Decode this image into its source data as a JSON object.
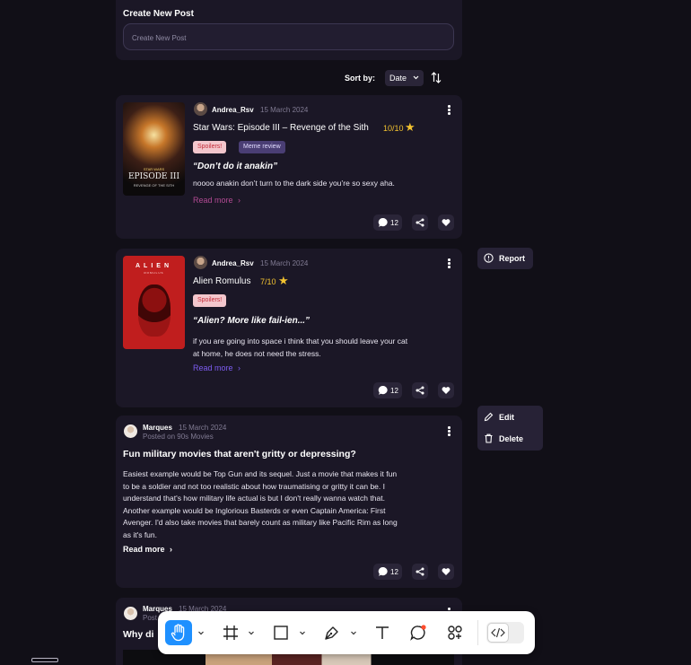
{
  "create_post": {
    "title": "Create New Post",
    "placeholder": "Create New Post"
  },
  "sort": {
    "label": "Sort by:",
    "value": "Date"
  },
  "posts": [
    {
      "author": "Andrea_Rsv",
      "date": "15 March 2024",
      "movie": "Star Wars: Episode III – Revenge of the Sith",
      "rating": "10/10",
      "tags": [
        "Spoilers!",
        "Meme review"
      ],
      "quote": "“Don’t do it anakin”",
      "body": "noooo anakin don’t turn to the dark side you’re so sexy aha.",
      "read_more": "Read more",
      "comments": "12",
      "poster_title": "EPISODE III",
      "poster_subtitle": "REVENGE OF THE SITH",
      "poster_brand": "STAR WARS",
      "read_more_color": "#b24a93"
    },
    {
      "author": "Andrea_Rsv",
      "date": "15 March 2024",
      "movie": "Alien Romulus",
      "rating": "7/10",
      "tags": [
        "Spoilers!"
      ],
      "quote": "“Alien? More like fail-ien...”",
      "body_lines": [
        "if you are going into space i think that you should leave your cat",
        "at home, he does not need the stress."
      ],
      "read_more": "Read more",
      "comments": "12",
      "poster_title": "ALIEN",
      "poster_subtitle": "ROMULUS",
      "read_more_color": "#7d5cf0"
    },
    {
      "author": "Marques",
      "date": "15 March 2024",
      "posted_on": "Posted on 90s Movies",
      "title": "Fun military movies that aren't gritty or depressing?",
      "body_lines": [
        "Easiest example would be Top Gun and its sequel. Just a movie that makes it fun",
        "to be a soldier and not too realistic about how traumatising or gritty it can be. I",
        "understand that's how military life actual is but I don't really wanna watch that.",
        "Another example would be Inglorious Basterds or even Captain America: First",
        "Avenger. I'd also take movies that barely count as military like Pacific Rim as long",
        "as it's fun."
      ],
      "read_more": "Read more",
      "comments": "12"
    },
    {
      "author": "Marques",
      "date": "15 March 2024",
      "posted_on_partial": "Post",
      "title_partial": "Why di"
    }
  ],
  "context_menu_report": {
    "label": "Report"
  },
  "context_menu_edit": {
    "edit": "Edit",
    "delete": "Delete"
  },
  "toolbar": {
    "tools": [
      "hand-tool",
      "frame-tool",
      "rectangle-tool",
      "pen-tool",
      "text-tool",
      "comment-tool",
      "components-tool",
      "dev-mode-toggle"
    ],
    "active_color": "#1e90ff"
  }
}
